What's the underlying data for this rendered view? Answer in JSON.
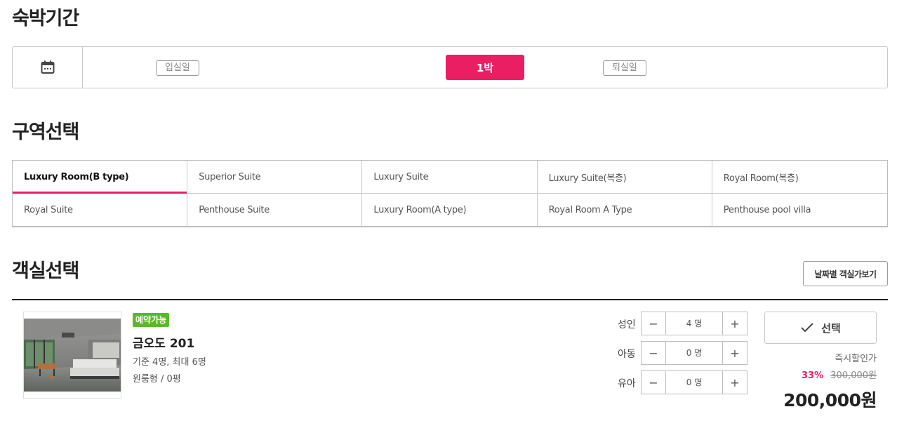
{
  "stay": {
    "title": "숙박기간",
    "checkin_label": "입실일",
    "nights_label": "1박",
    "checkout_label": "퇴실일"
  },
  "zones": {
    "title": "구역선택",
    "items": [
      {
        "label": "Luxury Room(B type)",
        "active": true
      },
      {
        "label": "Superior Suite"
      },
      {
        "label": "Luxury Suite"
      },
      {
        "label": "Luxury Suite(복층)"
      },
      {
        "label": "Royal Room(복층)"
      },
      {
        "label": "Royal Suite"
      },
      {
        "label": "Penthouse Suite"
      },
      {
        "label": "Luxury Room(A type)"
      },
      {
        "label": "Royal Room A Type"
      },
      {
        "label": "Penthouse pool villa"
      }
    ]
  },
  "rooms": {
    "title": "객실선택",
    "by_date_button": "날짜별 객실가보기",
    "room": {
      "badge": "예약가능",
      "name": "금오도 201",
      "capacity": "기준 4명, 최대 6명",
      "type": "원룸형 / 0평",
      "guests": [
        {
          "label": "성인",
          "value": "4 명"
        },
        {
          "label": "아동",
          "value": "0 명"
        },
        {
          "label": "유아",
          "value": "0 명"
        }
      ],
      "select_button": "선택",
      "instant_discount": "즉시할인가",
      "discount_rate": "33%",
      "original_price": "300,000원",
      "final_price": "200,000원"
    }
  },
  "icons": {
    "calendar": "calendar-icon",
    "minus": "minus-icon",
    "plus": "plus-icon",
    "check": "check-icon",
    "minus_glyph": "−",
    "plus_glyph": "+"
  },
  "colors": {
    "accent": "#e91e63",
    "available": "#5cb82b"
  }
}
